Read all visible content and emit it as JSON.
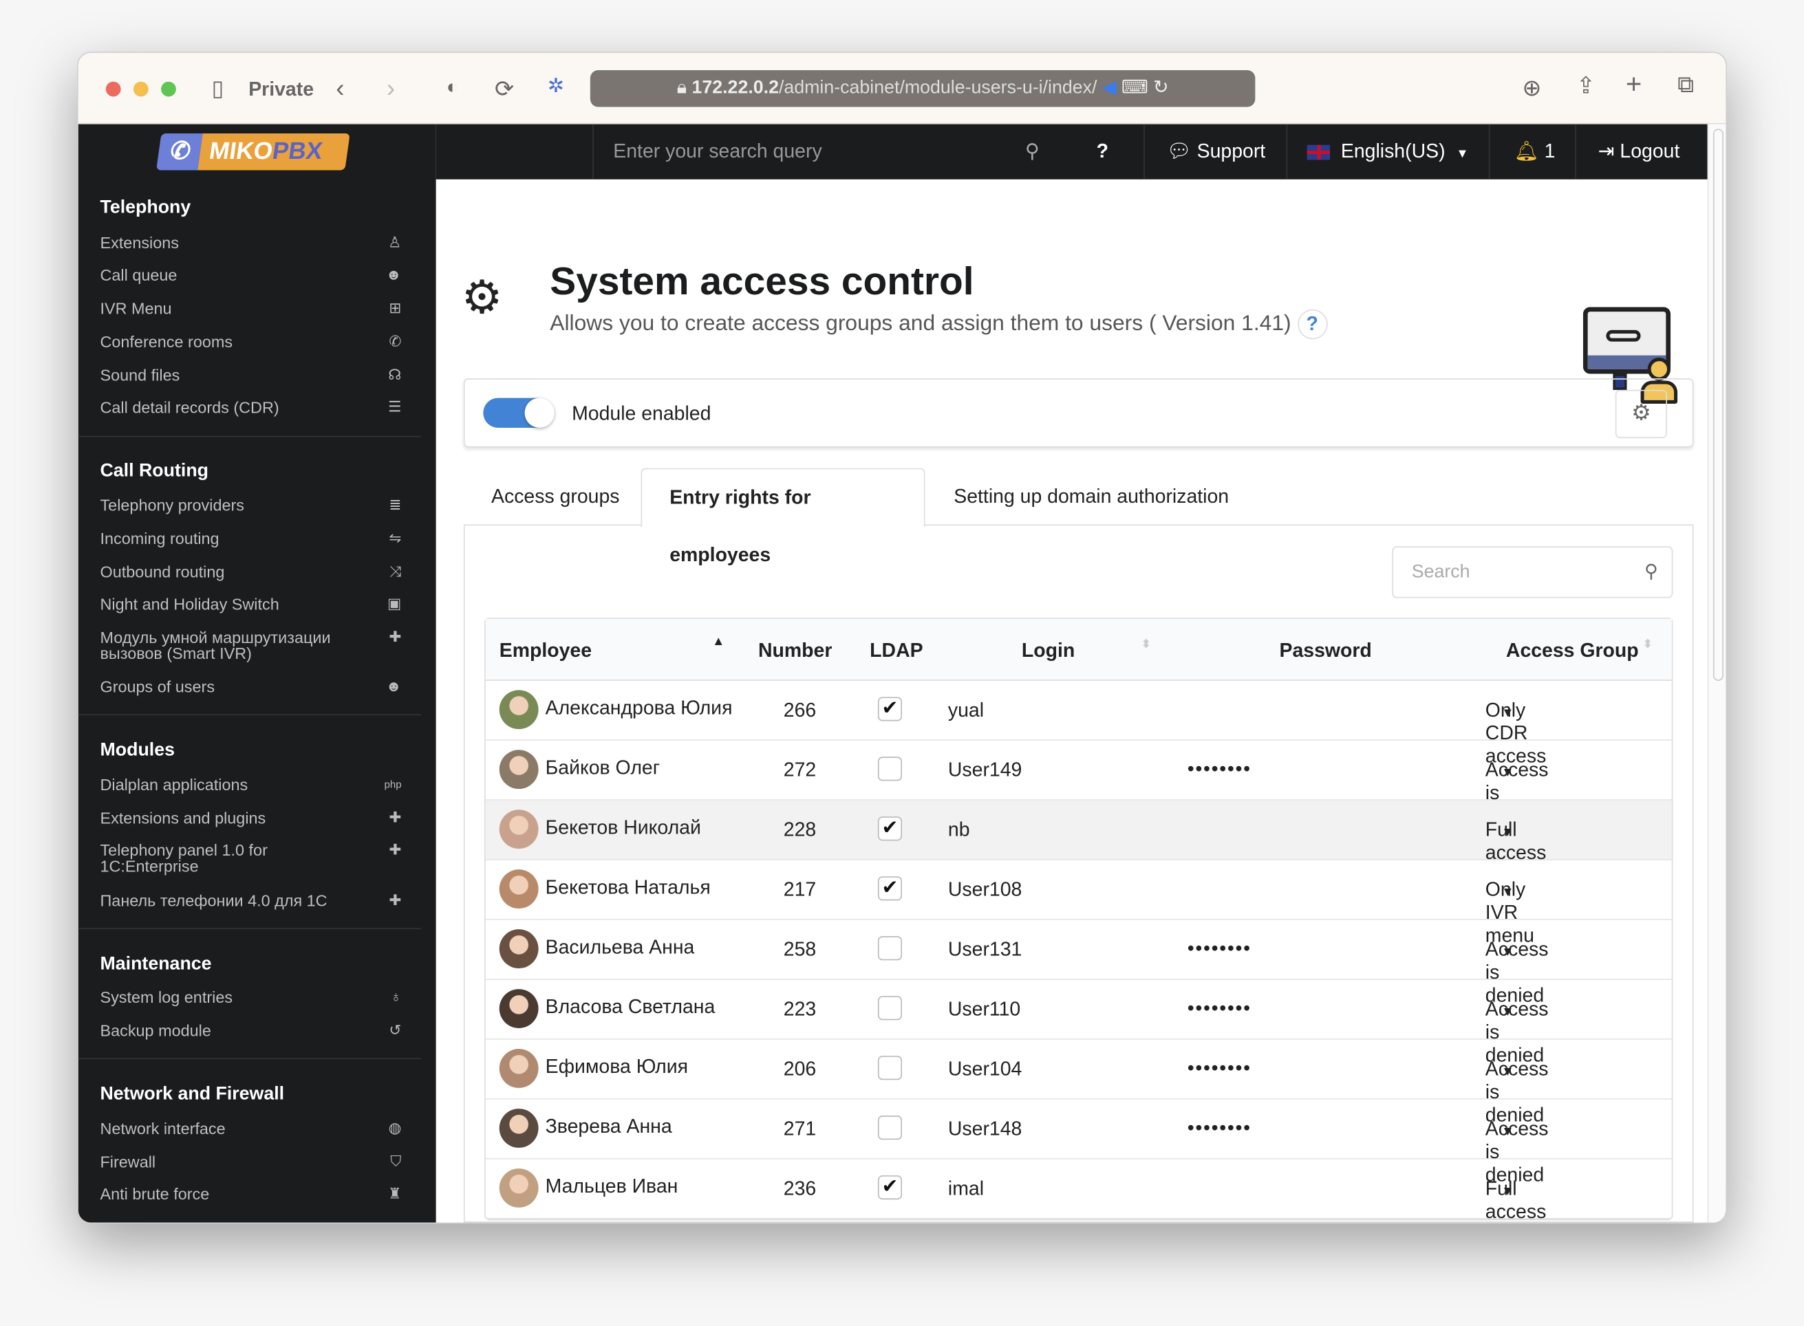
{
  "browser": {
    "private_label": "Private",
    "url_host": "172.22.0.2",
    "url_path": "/admin-cabinet/module-users-u-i/index/"
  },
  "logo": {
    "text_a": "MIKO",
    "text_b": "PBX"
  },
  "topbar": {
    "search_placeholder": "Enter your search query",
    "help": "?",
    "support": "Support",
    "language": "English(US)",
    "notifications": "1",
    "logout": "Logout"
  },
  "sidebar": [
    {
      "title": "Telephony",
      "items": [
        [
          "Extensions",
          "user-icon",
          "♙"
        ],
        [
          "Call queue",
          "users-icon",
          "☻"
        ],
        [
          "IVR Menu",
          "sitemap-icon",
          "⊞"
        ],
        [
          "Conference rooms",
          "phone-volume-icon",
          "✆"
        ],
        [
          "Sound files",
          "headphones-icon",
          "☊"
        ],
        [
          "Call detail records (CDR)",
          "list-icon",
          "☰"
        ]
      ]
    },
    {
      "title": "Call Routing",
      "items": [
        [
          "Telephony providers",
          "server-icon",
          "≣"
        ],
        [
          "Incoming routing",
          "signpost-icon",
          "⇋"
        ],
        [
          "Outbound routing",
          "random-icon",
          "⤨"
        ],
        [
          "Night and Holiday Switch",
          "calendar-x-icon",
          "▣"
        ],
        [
          "Модуль умной маршрутизации вызовов (Smart IVR)",
          "puzzle-icon",
          "✚"
        ],
        [
          "Groups of users",
          "users-icon",
          "☻"
        ]
      ]
    },
    {
      "title": "Modules",
      "items": [
        [
          "Dialplan applications",
          "php-icon",
          "php"
        ],
        [
          "Extensions and plugins",
          "puzzle-icon",
          "✚"
        ],
        [
          "Telephony panel 1.0 for 1C:Enterprise",
          "puzzle-icon",
          "✚"
        ],
        [
          "Панель телефонии 4.0 для 1С",
          "puzzle-icon",
          "✚"
        ]
      ]
    },
    {
      "title": "Maintenance",
      "items": [
        [
          "System log entries",
          "stethoscope-icon",
          "♁"
        ],
        [
          "Backup module",
          "history-icon",
          "↺"
        ]
      ]
    },
    {
      "title": "Network and Firewall",
      "items": [
        [
          "Network interface",
          "globe-icon",
          "◍"
        ],
        [
          "Firewall",
          "shield-icon",
          "⛉"
        ],
        [
          "Anti brute force",
          "user-secret-icon",
          "♜"
        ]
      ]
    }
  ],
  "page": {
    "title": "System access control",
    "subtitle": "Allows you to create access groups and assign them to users ( Version 1.41)",
    "help": "?",
    "module_enabled_label": "Module enabled",
    "module_enabled": true,
    "accent": "#4283d6"
  },
  "tabs": [
    "Access groups",
    "Entry rights for employees",
    "Setting up domain authorization"
  ],
  "active_tab": 1,
  "table": {
    "search_placeholder": "Search",
    "columns": [
      "Employee",
      "Number",
      "LDAP",
      "Login",
      "Password",
      "Access Group"
    ],
    "sort": {
      "column": "Employee",
      "direction": "ascending"
    },
    "rows": [
      {
        "name": "Александрова Юлия",
        "number": "266",
        "ldap": true,
        "login": "yual",
        "password": "",
        "group": "Only CDR access"
      },
      {
        "name": "Байков Олег",
        "number": "272",
        "ldap": false,
        "login": "User149",
        "password": "••••••••",
        "group": "Access is denied"
      },
      {
        "name": "Бекетов Николай",
        "number": "228",
        "ldap": true,
        "login": "nb",
        "password": "",
        "group": "Full access"
      },
      {
        "name": "Бекетова Наталья",
        "number": "217",
        "ldap": true,
        "login": "User108",
        "password": "",
        "group": "Only IVR menu"
      },
      {
        "name": "Васильева Анна",
        "number": "258",
        "ldap": false,
        "login": "User131",
        "password": "••••••••",
        "group": "Access is denied"
      },
      {
        "name": "Власова Светлана",
        "number": "223",
        "ldap": false,
        "login": "User110",
        "password": "••••••••",
        "group": "Access is denied"
      },
      {
        "name": "Ефимова Юлия",
        "number": "206",
        "ldap": false,
        "login": "User104",
        "password": "••••••••",
        "group": "Access is denied"
      },
      {
        "name": "Зверева Анна",
        "number": "271",
        "ldap": false,
        "login": "User148",
        "password": "••••••••",
        "group": "Access is denied"
      },
      {
        "name": "Мальцев Иван",
        "number": "236",
        "ldap": true,
        "login": "imal",
        "password": "",
        "group": "Full access"
      }
    ],
    "page_fragment": "4"
  }
}
